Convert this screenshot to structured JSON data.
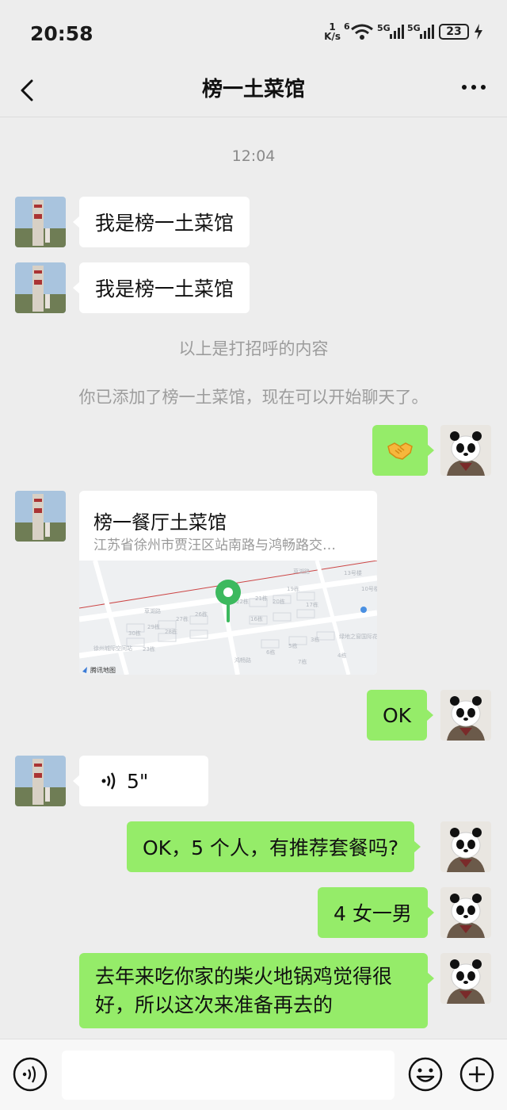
{
  "status_bar": {
    "time": "20:58",
    "net_speed_value": "1",
    "net_speed_unit": "K/s",
    "wifi_label": "6",
    "signal1_label": "5G",
    "signal2_label": "5G",
    "battery": "23"
  },
  "header": {
    "title": "榜一土菜馆"
  },
  "chat": {
    "timestamp": "12:04",
    "msg1": "我是榜一土菜馆",
    "msg2": "我是榜一土菜馆",
    "sys1": "以上是打招呼的内容",
    "sys2": "你已添加了榜一土菜馆，现在可以开始聊天了。",
    "handshake_icon": "handshake-emoji",
    "location": {
      "name": "榜一餐厅土菜馆",
      "address": "江苏省徐州市贾汪区站南路与鸿畅路交…",
      "map_brand": "腾讯地图",
      "map_labels": [
        "草湖路",
        "草湖路",
        "徐州城际空间站",
        "绿地之窗国际花园",
        "19栋",
        "20栋",
        "21栋",
        "22栋",
        "26栋",
        "27栋",
        "28栋",
        "29栋",
        "30栋",
        "23栋",
        "16栋",
        "17栋",
        "13号楼",
        "10号楼",
        "3栋",
        "4栋",
        "5栋",
        "6栋",
        "7栋",
        "鸿畅路"
      ]
    },
    "msg_ok": "OK",
    "voice_duration": "5\"",
    "msg_q": "OK，5 个人，有推荐套餐吗?",
    "msg_people": "4 女一男",
    "msg_long": "去年来吃你家的柴火地锅鸡觉得很好，所以这次来准备再去的"
  },
  "input_bar": {
    "text_value": ""
  },
  "colors": {
    "outgoing_bubble": "#95ec69",
    "incoming_bubble": "#ffffff",
    "background": "#ededed",
    "map_pin": "#3cb95e"
  }
}
